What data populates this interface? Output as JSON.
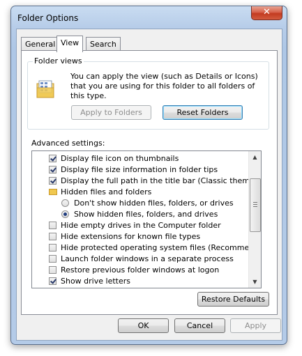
{
  "window": {
    "title": "Folder Options",
    "close_glyph": "✕"
  },
  "tabs": [
    {
      "label": "General",
      "active": false
    },
    {
      "label": "View",
      "active": true
    },
    {
      "label": "Search",
      "active": false
    }
  ],
  "folder_views": {
    "label": "Folder views",
    "description": "You can apply the view (such as Details or Icons) that you are using for this folder to all folders of this type.",
    "apply_button": "Apply to Folders",
    "reset_button": "Reset Folders"
  },
  "advanced": {
    "label": "Advanced settings:",
    "items": [
      {
        "kind": "checkbox",
        "checked": true,
        "indent": 1,
        "label": "Display file icon on thumbnails"
      },
      {
        "kind": "checkbox",
        "checked": true,
        "indent": 1,
        "label": "Display file size information in folder tips"
      },
      {
        "kind": "checkbox",
        "checked": true,
        "indent": 1,
        "label": "Display the full path in the title bar (Classic theme only)"
      },
      {
        "kind": "folder",
        "checked": false,
        "indent": 1,
        "label": "Hidden files and folders"
      },
      {
        "kind": "radio",
        "checked": false,
        "indent": 2,
        "label": "Don't show hidden files, folders, or drives"
      },
      {
        "kind": "radio",
        "checked": true,
        "indent": 2,
        "label": "Show hidden files, folders, and drives"
      },
      {
        "kind": "checkbox",
        "checked": false,
        "indent": 1,
        "label": "Hide empty drives in the Computer folder"
      },
      {
        "kind": "checkbox",
        "checked": false,
        "indent": 1,
        "label": "Hide extensions for known file types"
      },
      {
        "kind": "checkbox",
        "checked": false,
        "indent": 1,
        "label": "Hide protected operating system files (Recommended)"
      },
      {
        "kind": "checkbox",
        "checked": false,
        "indent": 1,
        "label": "Launch folder windows in a separate process"
      },
      {
        "kind": "checkbox",
        "checked": false,
        "indent": 1,
        "label": "Restore previous folder windows at logon"
      },
      {
        "kind": "checkbox",
        "checked": true,
        "indent": 1,
        "label": "Show drive letters"
      }
    ],
    "restore_button": "Restore Defaults"
  },
  "footer": {
    "ok": "OK",
    "cancel": "Cancel",
    "apply": "Apply"
  },
  "icons": {
    "folder": "folder-icon",
    "close": "close-icon",
    "scroll_up": "scroll-up-icon",
    "scroll_down": "scroll-down-icon"
  },
  "colors": {
    "accent": "#3c7fb1",
    "close": "#c23b20",
    "folder": "#f0c850"
  }
}
